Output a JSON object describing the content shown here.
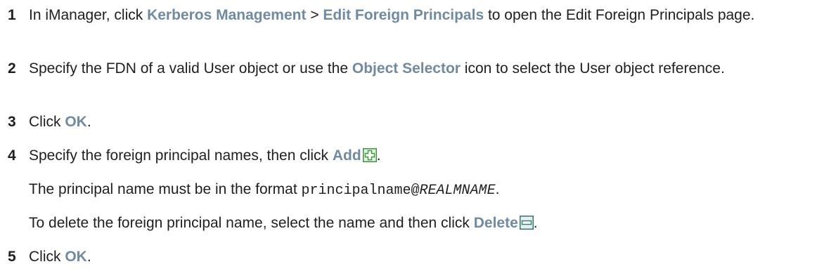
{
  "steps": [
    {
      "number": "1",
      "pre": "In iManager, click ",
      "ui1": "Kerberos Management",
      "sep": " > ",
      "ui2": "Edit Foreign Principals",
      "post": " to open the Edit Foreign Principals page."
    },
    {
      "number": "2",
      "pre": "Specify the FDN of a valid User object or use the ",
      "ui": "Object Selector",
      "post": " icon to select the User object reference."
    },
    {
      "number": "3",
      "pre": "Click ",
      "ui": "OK",
      "post": "."
    },
    {
      "number": "4",
      "pre": "Specify the foreign principal names, then click ",
      "ui": "Add",
      "icon": "add-icon",
      "post": "."
    },
    {
      "number": "5",
      "pre": "Click ",
      "ui": "OK",
      "post": "."
    }
  ],
  "note_format": {
    "pre": "The principal name must be in the format ",
    "code": "principalname@",
    "code_italic": "REALMNAME",
    "post": "."
  },
  "note_delete": {
    "pre": "To delete the foreign principal name, select the name and then click ",
    "ui": "Delete",
    "icon": "remove-icon",
    "post": "."
  },
  "colors": {
    "ui_term": "#6f8aa3",
    "text": "#1f1f1f",
    "add_icon_fill": "#dff0da",
    "add_icon_stroke": "#3a9a3a",
    "delete_icon_fill": "#e6ecf3",
    "delete_icon_stroke": "#2f7d6b"
  }
}
